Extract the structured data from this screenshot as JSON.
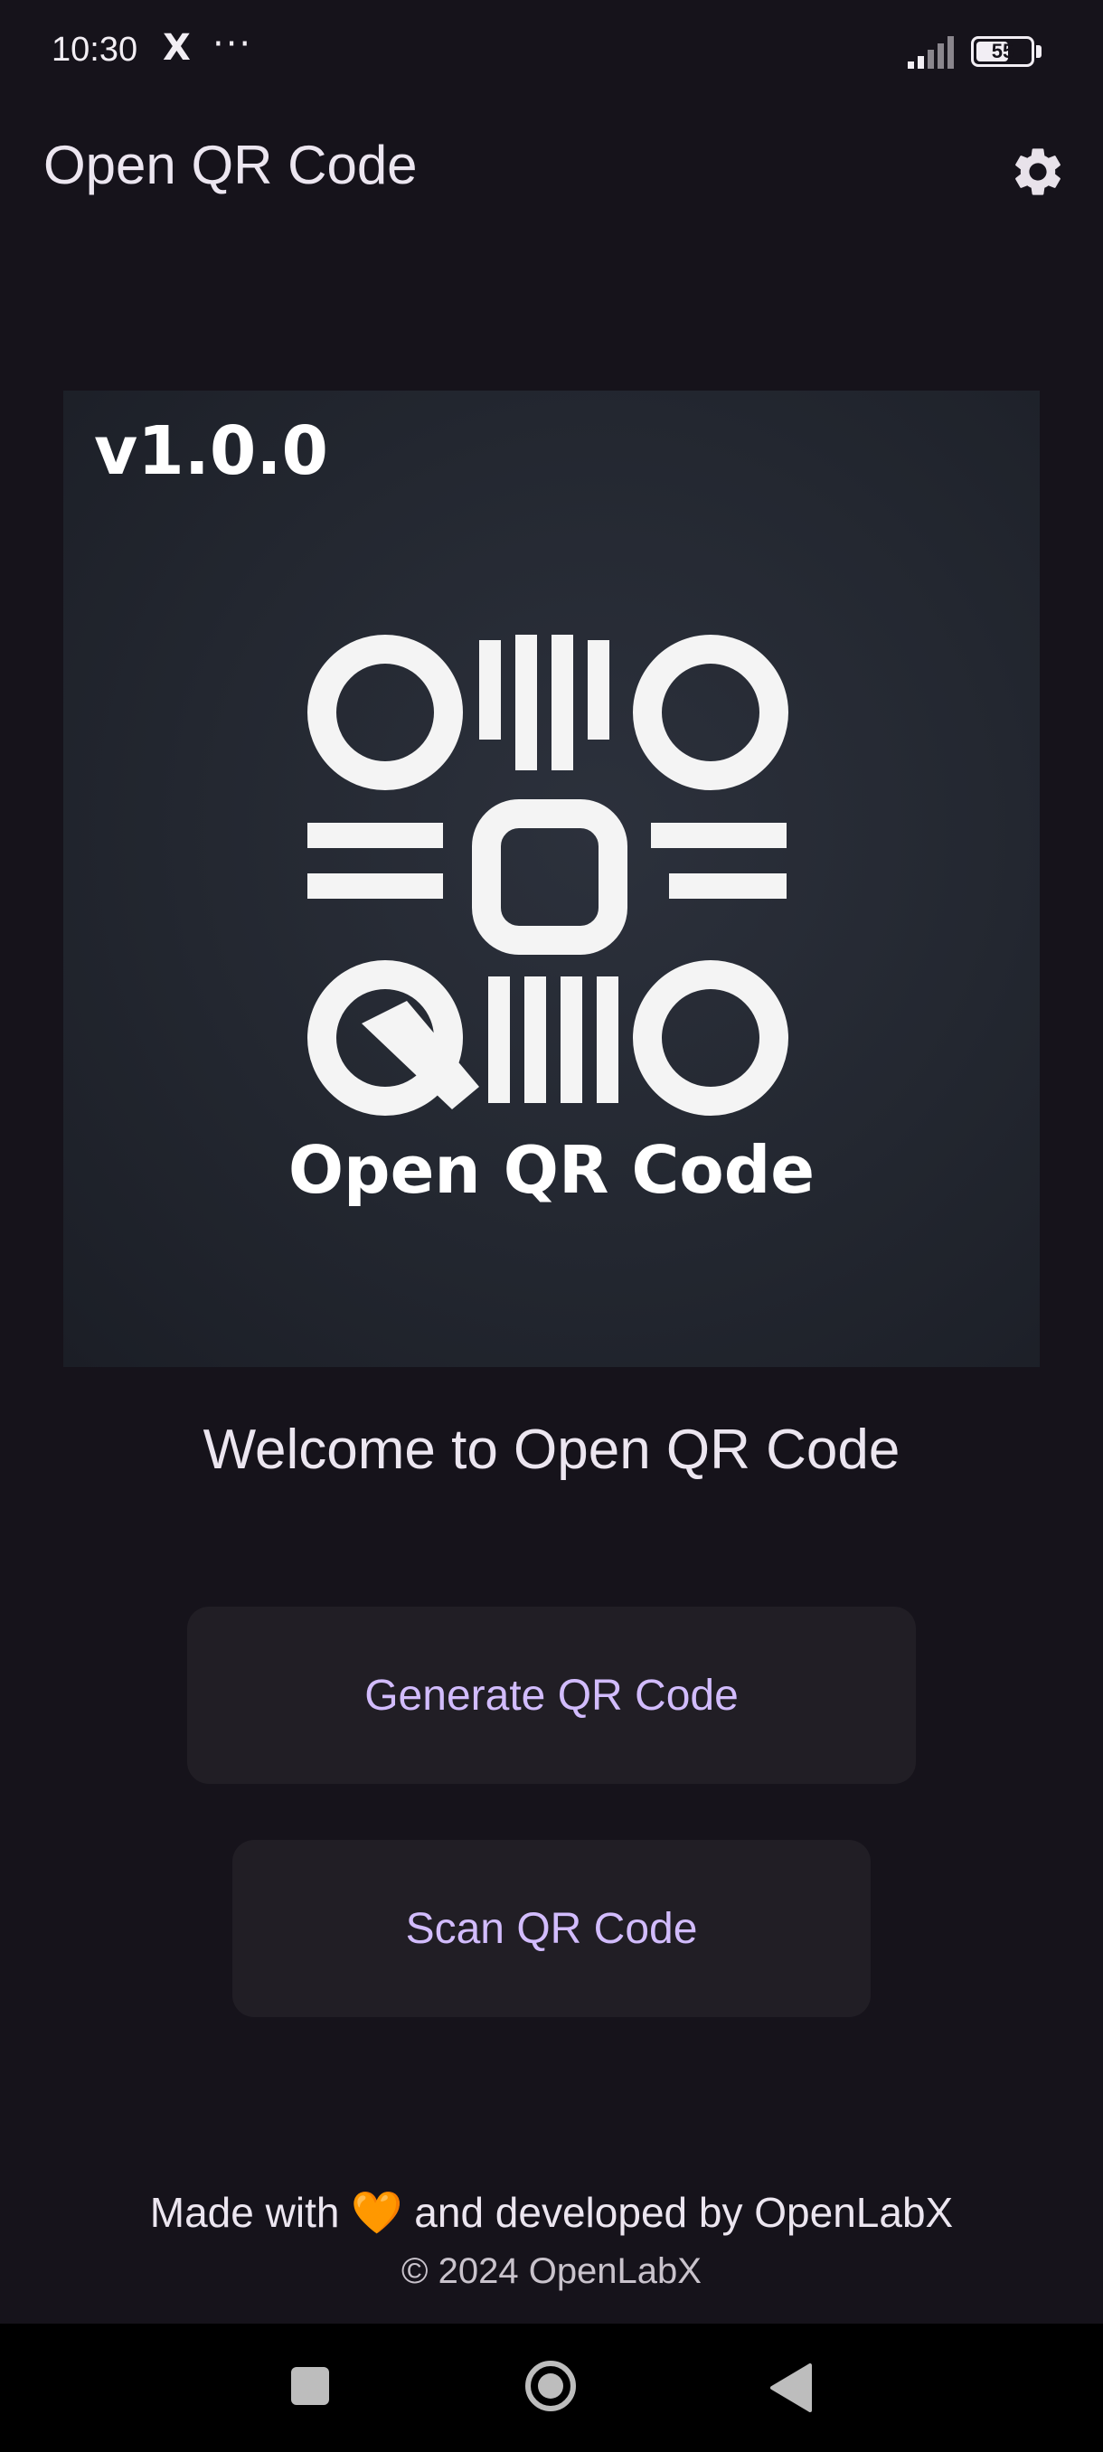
{
  "status_bar": {
    "time": "10:30",
    "x_icon": "X",
    "more": "···",
    "battery": "55",
    "icons": [
      "x-logo-icon",
      "more-icon",
      "signal-icon",
      "battery-icon"
    ]
  },
  "app_bar": {
    "title": "Open QR Code",
    "settings_icon": "gear-icon"
  },
  "logo": {
    "version": "v1.0.0",
    "name": "Open QR Code"
  },
  "welcome": "Welcome to Open QR Code",
  "buttons": {
    "generate": "Generate QR Code",
    "scan": "Scan QR Code"
  },
  "footer": {
    "made_prefix": "Made with",
    "heart": "🧡",
    "made_suffix": "and developed by OpenLabX",
    "copyright": "© 2024 OpenLabX"
  },
  "nav": {
    "icons": [
      "recents-icon",
      "home-icon",
      "back-icon"
    ]
  },
  "colors": {
    "background": "#16131b",
    "button_bg": "#211e25",
    "accent": "#d2bcfd",
    "heart": "#ff9a1f"
  }
}
